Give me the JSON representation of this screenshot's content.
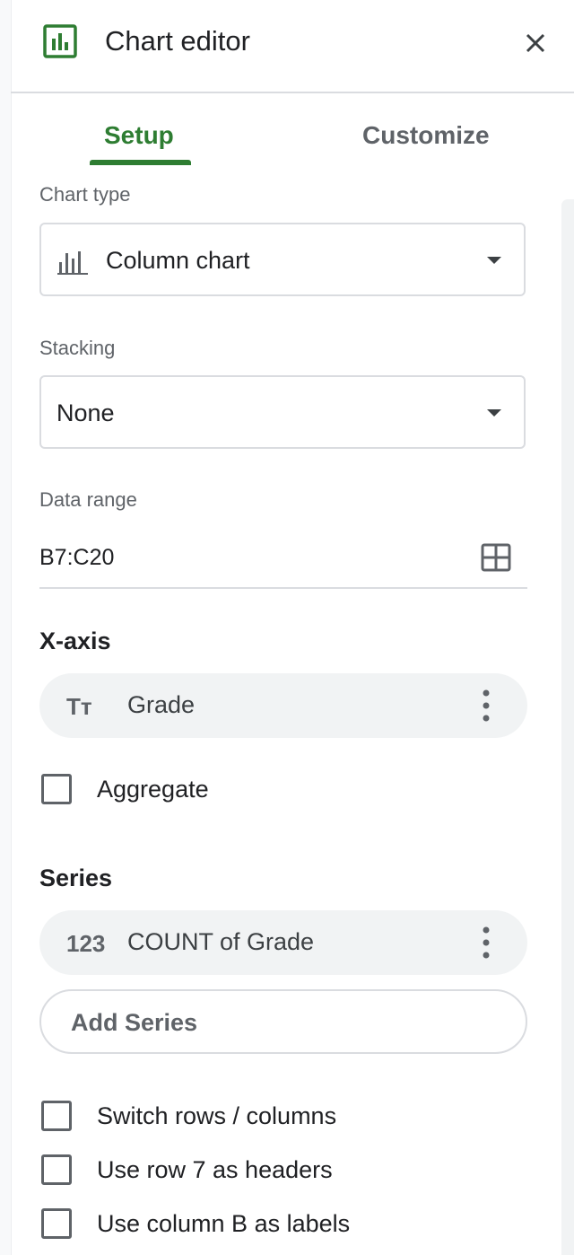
{
  "header": {
    "title": "Chart editor",
    "icon": "insert-chart-icon",
    "close_icon": "close-icon",
    "accent": "#2e7d32"
  },
  "tabs": [
    {
      "label": "Setup",
      "active": true
    },
    {
      "label": "Customize",
      "active": false
    }
  ],
  "chart_type": {
    "label": "Chart type",
    "value": "Column chart",
    "icon": "column-chart-icon"
  },
  "stacking": {
    "label": "Stacking",
    "value": "None"
  },
  "data_range": {
    "label": "Data range",
    "value": "B7:C20",
    "icon": "grid-select-icon"
  },
  "x_axis": {
    "title": "X-axis",
    "chip": {
      "icon_text": "Tт",
      "label": "Grade"
    },
    "aggregate": {
      "label": "Aggregate",
      "checked": false
    }
  },
  "series": {
    "title": "Series",
    "chip": {
      "icon_text": "123",
      "label": "COUNT of Grade"
    },
    "add_button": "Add Series"
  },
  "options": [
    {
      "label": "Switch rows / columns",
      "checked": false
    },
    {
      "label": "Use row 7 as headers",
      "checked": false
    },
    {
      "label": "Use column B as labels",
      "checked": false
    }
  ]
}
